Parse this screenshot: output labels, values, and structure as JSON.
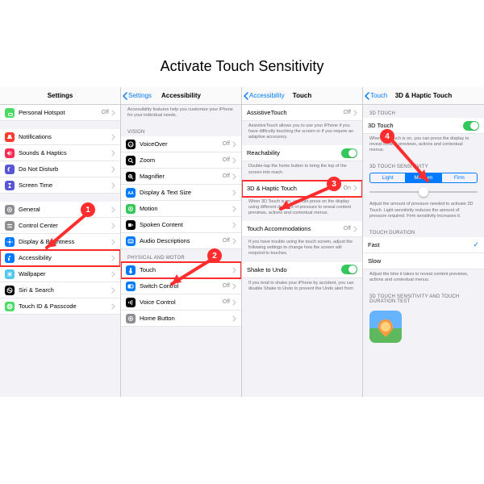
{
  "title": "Activate Touch Sensitivity",
  "badges": [
    "1",
    "2",
    "3",
    "4"
  ],
  "nav": {
    "settings": "Settings",
    "accessibility": "Accessibility",
    "touch": "Touch",
    "haptic": "3D & Haptic Touch"
  },
  "panel1": {
    "rows": [
      {
        "icon": "#4cd964",
        "g": "link",
        "label": "Personal Hotspot",
        "value": "Off",
        "chev": true
      },
      {
        "gap": true
      },
      {
        "icon": "#ff3b30",
        "g": "bell",
        "label": "Notifications",
        "chev": true
      },
      {
        "icon": "#ff2d55",
        "g": "sound",
        "label": "Sounds & Haptics",
        "chev": true
      },
      {
        "icon": "#5856d6",
        "g": "moon",
        "label": "Do Not Disturb",
        "chev": true
      },
      {
        "icon": "#5856d6",
        "g": "hour",
        "label": "Screen Time",
        "chev": true
      },
      {
        "gap": true
      },
      {
        "icon": "#8e8e93",
        "g": "gear",
        "label": "General",
        "chev": true
      },
      {
        "icon": "#8e8e93",
        "g": "cc",
        "label": "Control Center",
        "chev": true
      },
      {
        "icon": "#007aff",
        "g": "sun",
        "label": "Display & Brightness",
        "chev": true
      },
      {
        "icon": "#007aff",
        "g": "acc",
        "label": "Accessibility",
        "chev": true,
        "hl": true
      },
      {
        "icon": "#54c7ec",
        "g": "wall",
        "label": "Wallpaper",
        "chev": true
      },
      {
        "icon": "#000",
        "g": "siri",
        "label": "Siri & Search",
        "chev": true
      },
      {
        "icon": "#4cd964",
        "g": "fid",
        "label": "Touch ID & Passcode",
        "chev": true
      }
    ]
  },
  "panel2": {
    "intro": "Accessibility features help you customize your iPhone for your individual needs.",
    "sec1": "VISION",
    "rows1": [
      {
        "icon": "#000",
        "g": "vo",
        "label": "VoiceOver",
        "value": "Off",
        "chev": true
      },
      {
        "icon": "#000",
        "g": "zoom",
        "label": "Zoom",
        "value": "Off",
        "chev": true
      },
      {
        "icon": "#000",
        "g": "mag",
        "label": "Magnifier",
        "value": "Off",
        "chev": true
      },
      {
        "icon": "#007aff",
        "g": "aa",
        "label": "Display & Text Size",
        "chev": true
      },
      {
        "icon": "#34c759",
        "g": "mot",
        "label": "Motion",
        "chev": true
      },
      {
        "icon": "#000",
        "g": "spk",
        "label": "Spoken Content",
        "chev": true
      },
      {
        "icon": "#007aff",
        "g": "aud",
        "label": "Audio Descriptions",
        "value": "Off",
        "chev": true
      }
    ],
    "sec2": "PHYSICAL AND MOTOR",
    "rows2": [
      {
        "icon": "#007aff",
        "g": "tch",
        "label": "Touch",
        "chev": true,
        "hl": true
      },
      {
        "icon": "#007aff",
        "g": "swc",
        "label": "Switch Control",
        "value": "Off",
        "chev": true
      },
      {
        "icon": "#000",
        "g": "vc",
        "label": "Voice Control",
        "value": "Off",
        "chev": true
      },
      {
        "icon": "#8e8e93",
        "g": "hb",
        "label": "Home Button",
        "chev": true
      }
    ]
  },
  "panel3": {
    "rows": [
      {
        "label": "AssistiveTouch",
        "value": "Off",
        "chev": true
      },
      {
        "caption": "AssistiveTouch allows you to use your iPhone if you have difficulty touching the screen or if you require an adaptive accessory."
      },
      {
        "label": "Reachability",
        "toggle": "on"
      },
      {
        "caption": "Double-tap the home button to bring the top of the screen into reach."
      },
      {
        "label": "3D & Haptic Touch",
        "value": "On",
        "chev": true,
        "hl": true
      },
      {
        "caption": "When 3D Touch is on, you can press on the display using different degrees of pressure to reveal content previews, actions and contextual menus."
      },
      {
        "label": "Touch Accommodations",
        "value": "Off",
        "chev": true
      },
      {
        "caption": "If you have trouble using the touch screen, adjust the following settings to change how the screen will respond to touches."
      },
      {
        "label": "Shake to Undo",
        "toggle": "on"
      },
      {
        "caption": "If you tend to shake your iPhone by accident, you can disable Shake to Undo to prevent the Undo alert from"
      }
    ]
  },
  "panel4": {
    "sec1": "3D TOUCH",
    "toggle_label": "3D Touch",
    "cap1": "When 3D Touch is on, you can press the display to reveal content previews, actions and contextual menus.",
    "sec2": "3D TOUCH SENSITIVITY",
    "seg": [
      "Light",
      "Medium",
      "Firm"
    ],
    "seg_sel": 1,
    "slider_pos": 0.5,
    "cap2": "Adjust the amount of pressure needed to activate 3D Touch. Light sensitivity reduces the amount of pressure required. Firm sensitivity increases it.",
    "sec3": "TOUCH DURATION",
    "dur": [
      {
        "label": "Fast",
        "check": true
      },
      {
        "label": "Slow"
      }
    ],
    "cap3": "Adjust the time it takes to reveal content previews, actions and contextual menus.",
    "sec4": "3D TOUCH SENSITIVITY AND TOUCH DURATION TEST"
  }
}
